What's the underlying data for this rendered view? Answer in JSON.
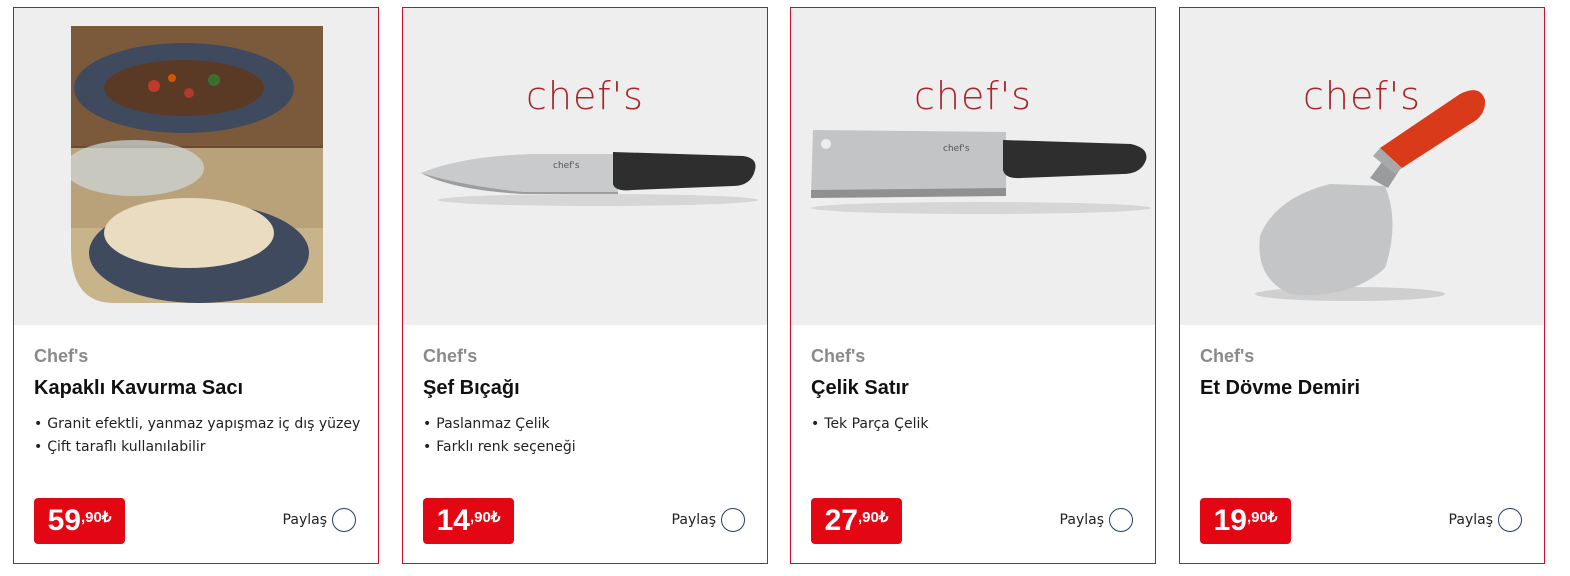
{
  "products": [
    {
      "brand": "Chef's",
      "title": "Kapaklı Kavurma Sacı",
      "features": [
        "Granit efektli, yanmaz yapışmaz iç dış yüzey",
        "Çift taraflı kullanılabilir"
      ],
      "price_int": "59",
      "price_dec": ",90₺",
      "share_label": "Paylaş"
    },
    {
      "brand": "Chef's",
      "logo": "chef's",
      "title": "Şef Bıçağı",
      "features": [
        "Paslanmaz Çelik",
        "Farklı renk seçeneği"
      ],
      "price_int": "14",
      "price_dec": ",90₺",
      "share_label": "Paylaş"
    },
    {
      "brand": "Chef's",
      "logo": "chef's",
      "title": "Çelik Satır",
      "features": [
        "Tek Parça Çelik"
      ],
      "price_int": "27",
      "price_dec": ",90₺",
      "share_label": "Paylaş"
    },
    {
      "brand": "Chef's",
      "logo": "chef's",
      "title": "Et Dövme Demiri",
      "features": [],
      "price_int": "19",
      "price_dec": ",90₺",
      "share_label": "Paylaş"
    }
  ],
  "colors": {
    "border": "#c8102e",
    "price_bg": "#e30613",
    "logo": "#a8262b"
  }
}
